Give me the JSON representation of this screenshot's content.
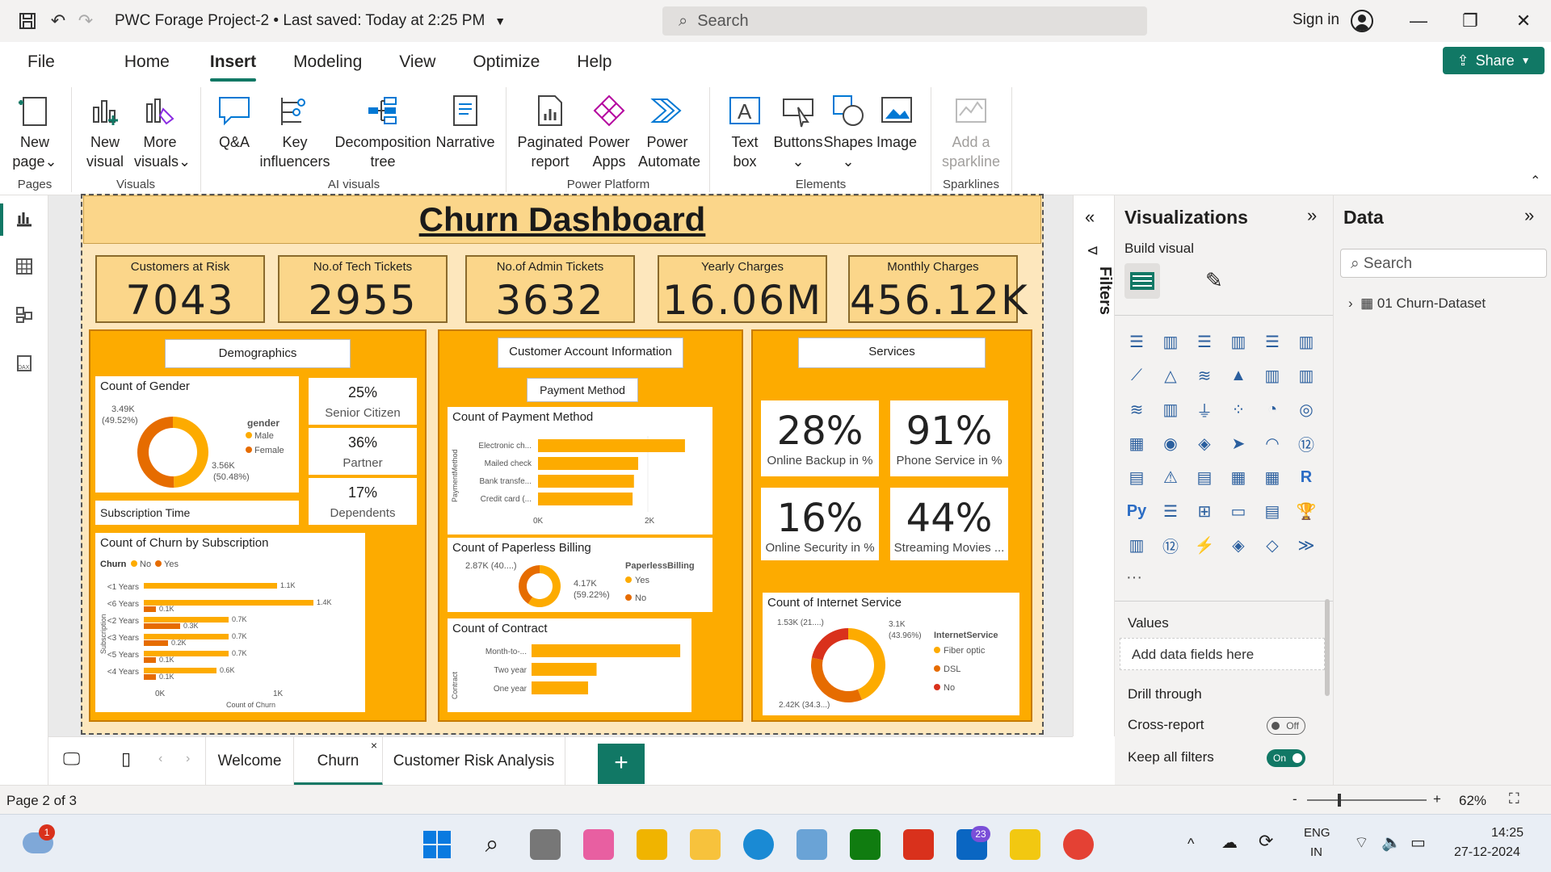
{
  "app": {
    "title": "PWC Forage Project-2 • Last saved: Today at 2:25 PM",
    "search_placeholder": "Search",
    "sign_in": "Sign in",
    "share": "Share"
  },
  "menu": [
    "File",
    "Home",
    "Insert",
    "Modeling",
    "View",
    "Optimize",
    "Help"
  ],
  "ribbon": {
    "new_page": [
      "New",
      "page"
    ],
    "new_visual": [
      "New",
      "visual"
    ],
    "more_visuals": [
      "More",
      "visuals"
    ],
    "qa": "Q&A",
    "key_influencers": [
      "Key",
      "influencers"
    ],
    "decomposition_tree": [
      "Decomposition",
      "tree"
    ],
    "narrative": "Narrative",
    "paginated_report": [
      "Paginated",
      "report"
    ],
    "power_apps": [
      "Power",
      "Apps"
    ],
    "power_automate": [
      "Power",
      "Automate"
    ],
    "text_box": [
      "Text",
      "box"
    ],
    "buttons": "Buttons",
    "shapes": "Shapes",
    "image": "Image",
    "add_sparkline": [
      "Add a",
      "sparkline"
    ],
    "groups": {
      "pages": "Pages",
      "visuals": "Visuals",
      "ai": "AI visuals",
      "platform": "Power Platform",
      "elements": "Elements",
      "sparklines": "Sparklines"
    }
  },
  "dashboard": {
    "title": "Churn Dashboard",
    "kpis": [
      {
        "label": "Customers at Risk",
        "value": "7043"
      },
      {
        "label": "No.of Tech Tickets",
        "value": "2955"
      },
      {
        "label": "No.of Admin Tickets",
        "value": "3632"
      },
      {
        "label": "Yearly Charges",
        "value": "16.06M"
      },
      {
        "label": "Monthly Charges",
        "value": "456.12K"
      }
    ],
    "demographics": {
      "header": "Demographics",
      "gender_title": "Count of Gender",
      "gender_legend_title": "gender",
      "gender_legend": [
        "Male",
        "Female"
      ],
      "gender_labels": [
        "3.49K",
        "(49.52%)",
        "3.56K",
        "(50.48%)"
      ],
      "senior": {
        "value": "25%",
        "label": "Senior Citizen"
      },
      "partner": {
        "value": "36%",
        "label": "Partner"
      },
      "dependents": {
        "value": "17%",
        "label": "Dependents"
      },
      "subscription_time": "Subscription Time",
      "churn_sub_title": "Count of Churn by Subscription",
      "churn_legend_title": "Churn",
      "churn_legend": [
        "No",
        "Yes"
      ],
      "y_axis_label": "Subscription",
      "x_axis_label": "Count of Churn",
      "x_ticks": [
        "0K",
        "1K"
      ]
    },
    "account": {
      "header": "Customer Account Information",
      "payment_header": "Payment Method",
      "payment_title": "Count of Payment Method",
      "payment_axis": "PaymentMethod",
      "payment_ticks": [
        "0K",
        "2K"
      ],
      "paperless_title": "Count of Paperless Billing",
      "paperless_legend_title": "PaperlessBilling",
      "paperless_legend": [
        "Yes",
        "No"
      ],
      "paperless_labels": [
        "2.87K (40....)",
        "4.17K",
        "(59.22%)"
      ],
      "contract_title": "Count of Contract",
      "contract_axis": "Contract"
    },
    "services": {
      "header": "Services",
      "cards": [
        {
          "value": "28%",
          "label": "Online Backup in %"
        },
        {
          "value": "91%",
          "label": "Phone Service in %"
        },
        {
          "value": "16%",
          "label": "Online Security in %"
        },
        {
          "value": "44%",
          "label": "Streaming Movies ..."
        }
      ],
      "internet_title": "Count of Internet Service",
      "internet_legend_title": "InternetService",
      "internet_legend": [
        "Fiber optic",
        "DSL",
        "No"
      ],
      "internet_labels": [
        "1.53K (21....)",
        "3.1K",
        "(43.96%)",
        "2.42K (34.3...)"
      ]
    }
  },
  "chart_data": [
    {
      "type": "pie",
      "title": "Count of Gender",
      "categories": [
        "Male",
        "Female"
      ],
      "values": [
        3490,
        3560
      ],
      "colors": [
        "#fdab00",
        "#e66c00"
      ]
    },
    {
      "type": "bar",
      "title": "Count of Churn by Subscription",
      "categories": [
        "<1 Years",
        "<6 Years",
        "<2 Years",
        "<3 Years",
        "<5 Years",
        "<4 Years"
      ],
      "series": [
        {
          "name": "No",
          "values": [
            1100,
            1400,
            700,
            700,
            700,
            600
          ]
        },
        {
          "name": "Yes",
          "values": [
            0,
            100,
            300,
            200,
            100,
            100
          ]
        }
      ],
      "data_labels": [
        [
          "1.1K",
          "1.4K",
          "0.7K",
          "0.7K",
          "0.7K",
          "0.6K"
        ],
        [
          "",
          "0.1K",
          "0.3K",
          "0.2K",
          "0.1K",
          "0.1K"
        ]
      ],
      "xlabel": "Count of Churn",
      "ylabel": "Subscription",
      "xlim": [
        0,
        1500
      ]
    },
    {
      "type": "bar",
      "title": "Count of Payment Method",
      "categories": [
        "Electronic ch...",
        "Mailed check",
        "Bank transfe...",
        "Credit card (..."
      ],
      "values": [
        2365,
        1612,
        1544,
        1522
      ],
      "ylabel": "PaymentMethod",
      "xlim": [
        0,
        2600
      ]
    },
    {
      "type": "pie",
      "title": "Count of Paperless Billing",
      "categories": [
        "Yes",
        "No"
      ],
      "values": [
        4170,
        2870
      ],
      "colors": [
        "#fdab00",
        "#e66c00"
      ]
    },
    {
      "type": "bar",
      "title": "Count of Contract",
      "categories": [
        "Month-to-...",
        "Two year",
        "One year"
      ],
      "values": [
        3875,
        1695,
        1473
      ],
      "ylabel": "Contract",
      "xlim": [
        0,
        4000
      ]
    },
    {
      "type": "pie",
      "title": "Count of Internet Service",
      "categories": [
        "Fiber optic",
        "DSL",
        "No"
      ],
      "values": [
        3100,
        2420,
        1530
      ],
      "colors": [
        "#fdab00",
        "#e66c00",
        "#d9311c"
      ]
    }
  ],
  "panes": {
    "filters": "Filters",
    "visualizations": "Visualizations",
    "build_visual": "Build visual",
    "values": "Values",
    "add_data": "Add data fields here",
    "drill_through": "Drill through",
    "cross_report": "Cross-report",
    "cross_report_state": "Off",
    "keep_filters": "Keep all filters",
    "keep_filters_state": "On",
    "data": "Data",
    "data_search": "Search",
    "dataset": "01 Churn-Dataset"
  },
  "tabs": [
    "Welcome",
    "Churn",
    "Customer Risk Analysis"
  ],
  "status": {
    "page": "Page 2 of 3",
    "zoom": "62%"
  },
  "taskbar": {
    "lang1": "ENG",
    "lang2": "IN",
    "time": "14:25",
    "date": "27-12-2024",
    "notif": "1",
    "linkedin_badge": "23"
  }
}
